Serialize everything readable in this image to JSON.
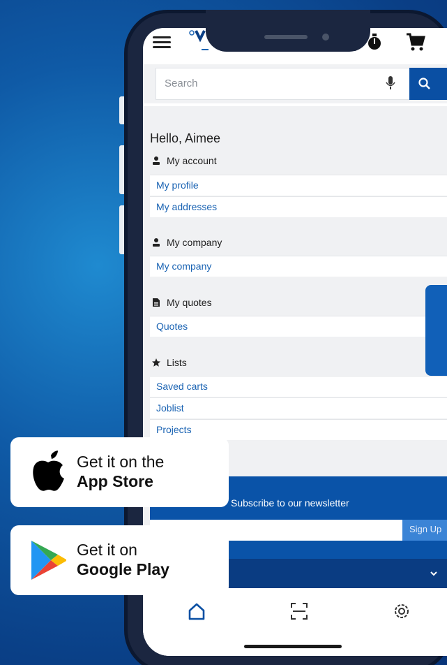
{
  "search": {
    "placeholder": "Search"
  },
  "greeting": "Hello, Aimee",
  "sections": [
    {
      "title": "My account",
      "icon": "user-icon",
      "links": [
        "My profile",
        "My addresses"
      ]
    },
    {
      "title": "My company",
      "icon": "user-icon",
      "links": [
        "My company"
      ]
    },
    {
      "title": "My quotes",
      "icon": "document-icon",
      "links": [
        "Quotes"
      ]
    },
    {
      "title": "Lists",
      "icon": "star-icon",
      "links": [
        "Saved carts",
        "Joblist",
        "Projects"
      ]
    }
  ],
  "newsletter": {
    "text": "Subscribe to our newsletter",
    "button": "Sign Up"
  },
  "bottom_nav": [
    "home-icon",
    "scan-icon",
    "settings-icon"
  ],
  "badges": {
    "app_store": {
      "pre": "Get it on the",
      "name": "App Store"
    },
    "google_play": {
      "pre": "Get it on",
      "name": "Google Play"
    }
  },
  "colors": {
    "brand_blue": "#0a4fa3",
    "link_blue": "#1a63b3",
    "background_blue": "#0f5aa6"
  }
}
